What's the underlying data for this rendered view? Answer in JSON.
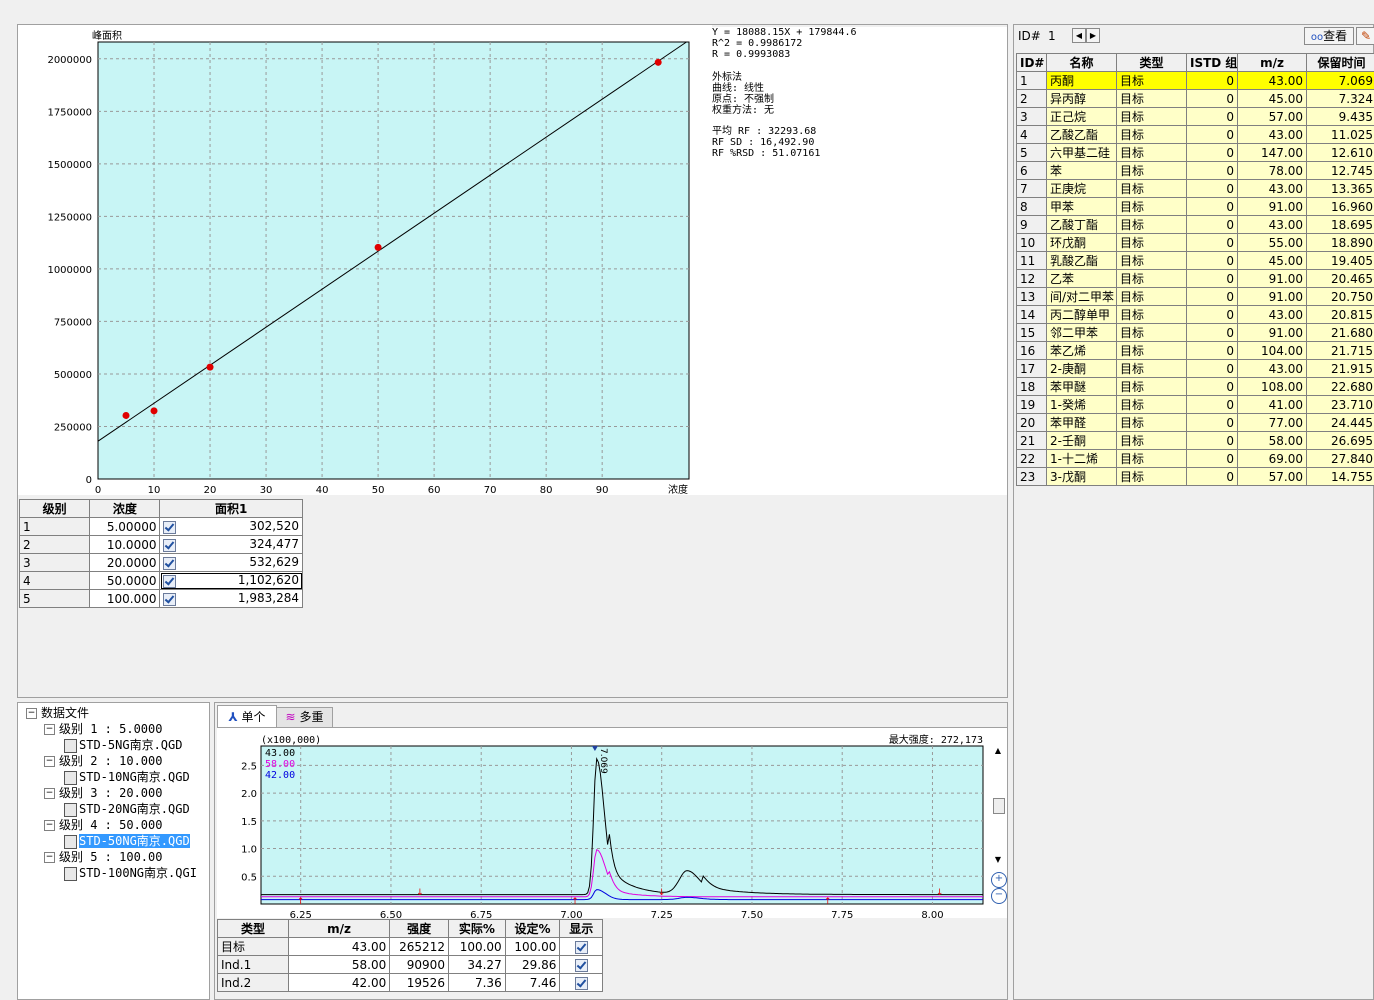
{
  "regression": {
    "equation": "Y = 18088.15X + 179844.6",
    "r2": "R^2 = 0.9986172",
    "r": "R = 0.9993083",
    "method": "外标法",
    "curve": "曲线: 线性",
    "origin": "原点: 不强制",
    "weight": "权重方法: 无",
    "avg_rf": "平均 RF :  32293.68",
    "rf_sd": "RF SD : 16,492.90",
    "rf_rsd": "RF %RSD : 51.07161"
  },
  "chart_data": {
    "type": "scatter",
    "ylabel": "峰面积",
    "xlabel": "浓度",
    "xlim": [
      0,
      105.5
    ],
    "ylim": [
      0,
      2080000
    ],
    "xticks": [
      "0",
      "10",
      "20",
      "30",
      "40",
      "50",
      "60",
      "70",
      "80",
      "90"
    ],
    "yticks": [
      "0",
      "250000",
      "500000",
      "750000",
      "1000000",
      "1250000",
      "1500000",
      "1750000",
      "2000000"
    ],
    "points": [
      {
        "x": 5,
        "y": 302520
      },
      {
        "x": 10,
        "y": 324477
      },
      {
        "x": 20,
        "y": 532629
      },
      {
        "x": 50,
        "y": 1102620
      },
      {
        "x": 100,
        "y": 1983284
      }
    ],
    "fit": {
      "slope": 18088.15,
      "intercept": 179844.6
    },
    "grid": true,
    "colors": {
      "bg": "#c8f5f5",
      "point": "#e00000",
      "line": "#000000"
    }
  },
  "level_table": {
    "headers": [
      "级别",
      "浓度",
      "面积1"
    ],
    "rows": [
      {
        "level": "1",
        "conc": "5.00000",
        "area": "302,520"
      },
      {
        "level": "2",
        "conc": "10.0000",
        "area": "324,477"
      },
      {
        "level": "3",
        "conc": "20.0000",
        "area": "532,629"
      },
      {
        "level": "4",
        "conc": "50.0000",
        "area": "1,102,620"
      },
      {
        "level": "5",
        "conc": "100.000",
        "area": "1,983,284"
      }
    ]
  },
  "compound_panel": {
    "id_label": "ID#",
    "id_value": "1",
    "view_button": "查看",
    "headers": [
      "ID#",
      "名称",
      "类型",
      "ISTD 组",
      "m/z",
      "保留时间"
    ],
    "rows": [
      {
        "id": "1",
        "name": "丙酮",
        "type": "目标",
        "istd": "0",
        "mz": "43.00",
        "rt": "7.069"
      },
      {
        "id": "2",
        "name": "异丙醇",
        "type": "目标",
        "istd": "0",
        "mz": "45.00",
        "rt": "7.324"
      },
      {
        "id": "3",
        "name": "正己烷",
        "type": "目标",
        "istd": "0",
        "mz": "57.00",
        "rt": "9.435"
      },
      {
        "id": "4",
        "name": "乙酸乙酯",
        "type": "目标",
        "istd": "0",
        "mz": "43.00",
        "rt": "11.025"
      },
      {
        "id": "5",
        "name": "六甲基二硅",
        "type": "目标",
        "istd": "0",
        "mz": "147.00",
        "rt": "12.610"
      },
      {
        "id": "6",
        "name": "苯",
        "type": "目标",
        "istd": "0",
        "mz": "78.00",
        "rt": "12.745"
      },
      {
        "id": "7",
        "name": "正庚烷",
        "type": "目标",
        "istd": "0",
        "mz": "43.00",
        "rt": "13.365"
      },
      {
        "id": "8",
        "name": "甲苯",
        "type": "目标",
        "istd": "0",
        "mz": "91.00",
        "rt": "16.960"
      },
      {
        "id": "9",
        "name": "乙酸丁酯",
        "type": "目标",
        "istd": "0",
        "mz": "43.00",
        "rt": "18.695"
      },
      {
        "id": "10",
        "name": "环戊酮",
        "type": "目标",
        "istd": "0",
        "mz": "55.00",
        "rt": "18.890"
      },
      {
        "id": "11",
        "name": "乳酸乙酯",
        "type": "目标",
        "istd": "0",
        "mz": "45.00",
        "rt": "19.405"
      },
      {
        "id": "12",
        "name": "乙苯",
        "type": "目标",
        "istd": "0",
        "mz": "91.00",
        "rt": "20.465"
      },
      {
        "id": "13",
        "name": "间/对二甲苯",
        "type": "目标",
        "istd": "0",
        "mz": "91.00",
        "rt": "20.750"
      },
      {
        "id": "14",
        "name": "丙二醇单甲",
        "type": "目标",
        "istd": "0",
        "mz": "43.00",
        "rt": "20.815"
      },
      {
        "id": "15",
        "name": "邻二甲苯",
        "type": "目标",
        "istd": "0",
        "mz": "91.00",
        "rt": "21.680"
      },
      {
        "id": "16",
        "name": "苯乙烯",
        "type": "目标",
        "istd": "0",
        "mz": "104.00",
        "rt": "21.715"
      },
      {
        "id": "17",
        "name": "2-庚酮",
        "type": "目标",
        "istd": "0",
        "mz": "43.00",
        "rt": "21.915"
      },
      {
        "id": "18",
        "name": "苯甲醚",
        "type": "目标",
        "istd": "0",
        "mz": "108.00",
        "rt": "22.680"
      },
      {
        "id": "19",
        "name": "1-癸烯",
        "type": "目标",
        "istd": "0",
        "mz": "41.00",
        "rt": "23.710"
      },
      {
        "id": "20",
        "name": "苯甲醛",
        "type": "目标",
        "istd": "0",
        "mz": "77.00",
        "rt": "24.445"
      },
      {
        "id": "21",
        "name": "2-壬酮",
        "type": "目标",
        "istd": "0",
        "mz": "58.00",
        "rt": "26.695"
      },
      {
        "id": "22",
        "name": "1-十二烯",
        "type": "目标",
        "istd": "0",
        "mz": "69.00",
        "rt": "27.840"
      },
      {
        "id": "23",
        "name": "3-戊酮",
        "type": "目标",
        "istd": "0",
        "mz": "57.00",
        "rt": "14.755"
      }
    ]
  },
  "tree": {
    "root": "数据文件",
    "levels": [
      {
        "label": "级别 1 : 5.0000",
        "file": "STD-5NG南京.QGD"
      },
      {
        "label": "级别 2 : 10.000",
        "file": "STD-10NG南京.QGD"
      },
      {
        "label": "级别 3 : 20.000",
        "file": "STD-20NG南京.QGD"
      },
      {
        "label": "级别 4 : 50.000",
        "file": "STD-50NG南京.QGD"
      },
      {
        "label": "级别 5 : 100.00",
        "file": "STD-100NG南京.QGI"
      }
    ]
  },
  "chromatogram": {
    "tab_single": "单个",
    "tab_multi": "多重",
    "scale": "(x100,000)",
    "max_intensity": "最大强度: 272,173",
    "legend": [
      {
        "mz": "43.00",
        "color": "#000000"
      },
      {
        "mz": "58.00",
        "color": "#e000e0"
      },
      {
        "mz": "42.00",
        "color": "#0000e0"
      }
    ],
    "peak_label": "7.069",
    "xticks": [
      "6.25",
      "6.50",
      "6.75",
      "7.00",
      "7.25",
      "7.50",
      "7.75",
      "8.00"
    ],
    "yticks": [
      "0.5",
      "1.0",
      "1.5",
      "2.0",
      "2.5"
    ]
  },
  "ion_table": {
    "headers": [
      "类型",
      "m/z",
      "强度",
      "实际%",
      "设定%",
      "显示"
    ],
    "rows": [
      {
        "type": "目标",
        "mz": "43.00",
        "intensity": "265212",
        "actual": "100.00",
        "set": "100.00"
      },
      {
        "type": "Ind.1",
        "mz": "58.00",
        "intensity": "90900",
        "actual": "34.27",
        "set": "29.86"
      },
      {
        "type": "Ind.2",
        "mz": "42.00",
        "intensity": "19526",
        "actual": "7.36",
        "set": "7.46"
      }
    ]
  }
}
